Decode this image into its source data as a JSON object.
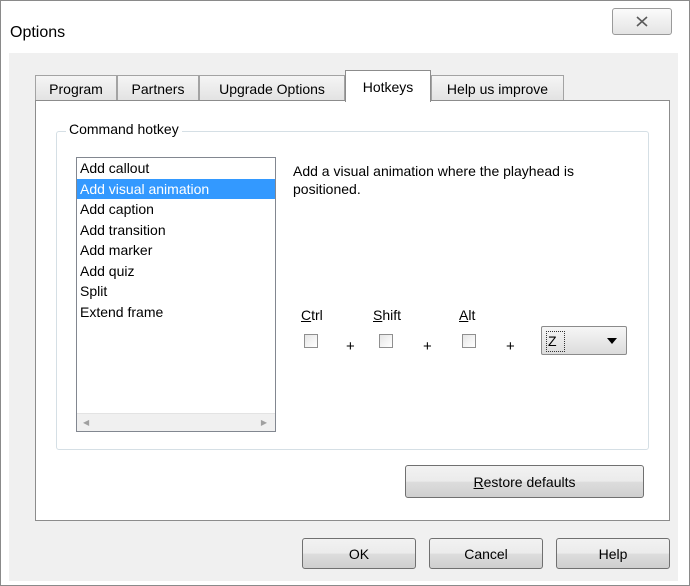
{
  "window": {
    "title": "Options"
  },
  "tabs": [
    {
      "label": "Program"
    },
    {
      "label": "Partners"
    },
    {
      "label": "Upgrade Options"
    },
    {
      "label": "Hotkeys"
    },
    {
      "label": "Help us improve"
    }
  ],
  "active_tab": "Hotkeys",
  "command_hotkey": {
    "group_label": "Command hotkey",
    "commands": [
      "Add callout",
      "Add visual animation",
      "Add caption",
      "Add transition",
      "Add marker",
      "Add quiz",
      "Split",
      "Extend frame"
    ],
    "selected_command": "Add visual animation",
    "description": "Add a visual animation where the playhead is positioned.",
    "modifiers": {
      "ctrl": {
        "label_mnemonic": "C",
        "label_rest": "trl",
        "checked": false
      },
      "shift": {
        "label_mnemonic": "S",
        "label_rest": "hift",
        "checked": false
      },
      "alt": {
        "label_mnemonic": "A",
        "label_rest": "lt",
        "checked": false
      }
    },
    "plus_sign": "+",
    "key_value": "Z"
  },
  "buttons": {
    "restore_mnemonic": "R",
    "restore_rest": "estore defaults",
    "ok": "OK",
    "cancel": "Cancel",
    "help": "Help"
  },
  "colors": {
    "selection": "#3399ff",
    "dialog_bg": "#f0f0f0"
  }
}
